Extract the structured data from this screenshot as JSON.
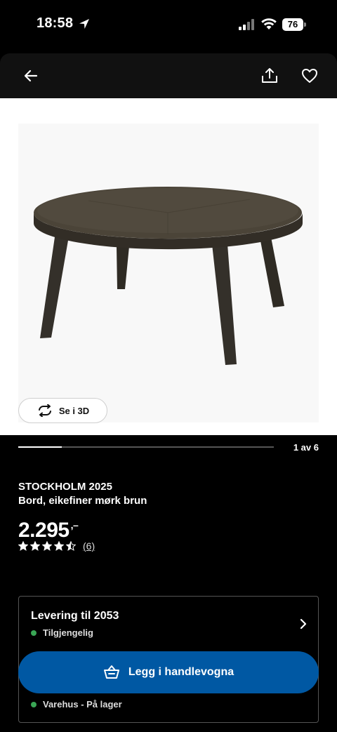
{
  "status_bar": {
    "time": "18:58",
    "battery": "76"
  },
  "nav": {
    "back": "arrow-left-icon",
    "share": "share-icon",
    "favourite": "heart-icon"
  },
  "gallery": {
    "view_3d_label": "Se i 3D",
    "counter": "1 av 6",
    "progress": 0.17
  },
  "product": {
    "name": "STOCKHOLM 2025",
    "description": "Bord, eikefiner mørk brun",
    "price": "2.295",
    "price_suffix": ",–",
    "rating": 4.5,
    "review_count": "(6)"
  },
  "availability": {
    "delivery_title": "Levering til 2053",
    "delivery_status": "Tilgjengelig",
    "store_status": "Varehus - På lager",
    "status_color": "#3aa655"
  },
  "cart": {
    "label": "Legg i handlevogna",
    "color": "#0058a3"
  }
}
